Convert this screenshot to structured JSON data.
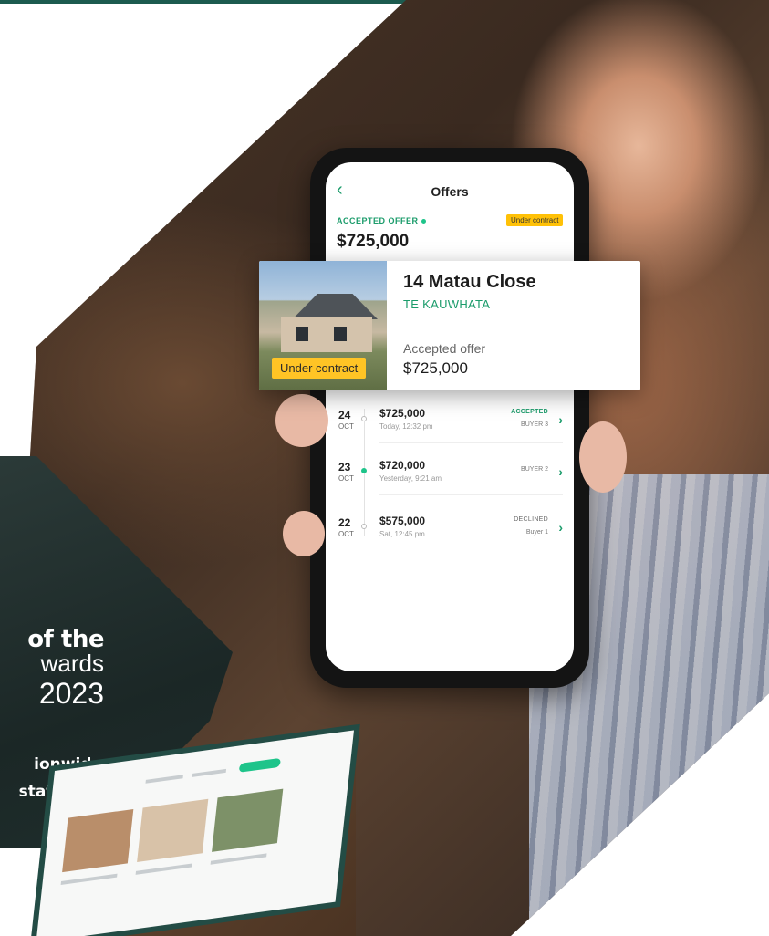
{
  "award": {
    "line1": "of the",
    "line2": "wards",
    "line3": "2023",
    "line4": "ionwide",
    "line5": "state"
  },
  "phone_app": {
    "title": "Offers",
    "accepted_label": "ACCEPTED OFFER",
    "status_tag": "Under contract",
    "accepted_amount": "$725,000"
  },
  "property_card": {
    "address": "14 Matau Close",
    "suburb": "TE KAUWHATA",
    "status_tag": "Under contract",
    "offer_label": "Accepted offer",
    "offer_amount": "$725,000"
  },
  "offers": [
    {
      "day": "24",
      "month": "OCT",
      "amount": "$725,000",
      "when": "Today, 12:32 pm",
      "status": "ACCEPTED",
      "buyer": "BUYER 3"
    },
    {
      "day": "23",
      "month": "OCT",
      "amount": "$720,000",
      "when": "Yesterday, 9:21 am",
      "status": "",
      "buyer": "BUYER 2"
    },
    {
      "day": "22",
      "month": "OCT",
      "amount": "$575,000",
      "when": "Sat, 12:45 pm",
      "status": "DECLINED",
      "buyer": "Buyer 1"
    }
  ],
  "colors": {
    "accent_green": "#1b9c6b",
    "tag_yellow": "#ffc425",
    "dark_teal": "#1c5b4f"
  }
}
